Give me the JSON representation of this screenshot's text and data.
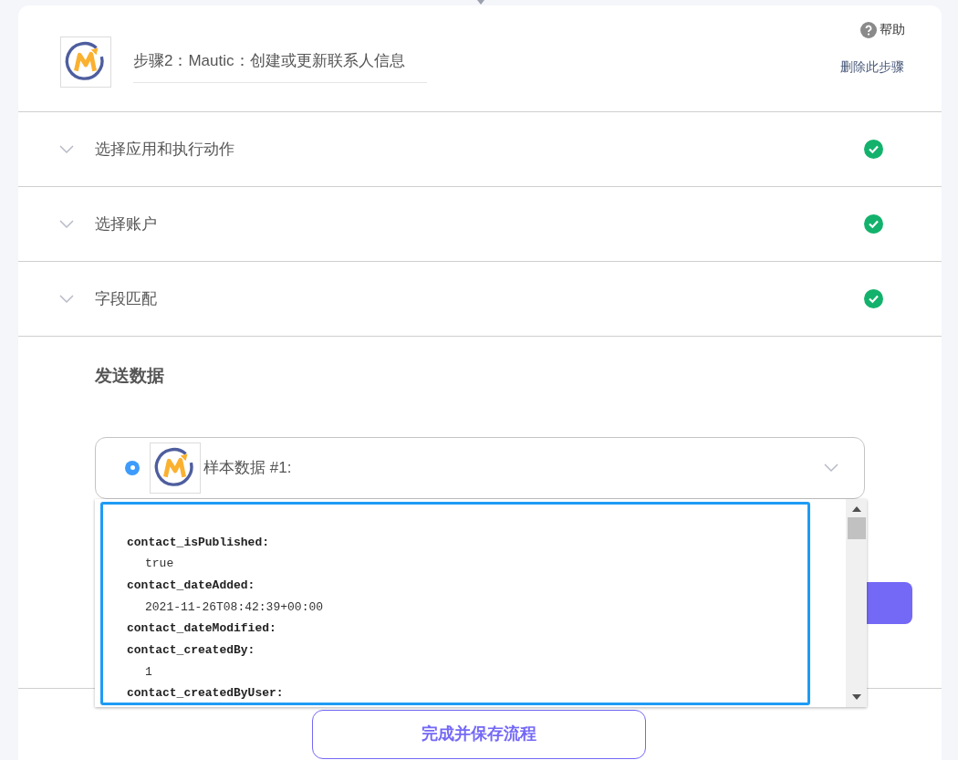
{
  "step": {
    "title": "步骤2：Mautic：创建或更新联系人信息",
    "help": "帮助",
    "delete": "删除此步骤"
  },
  "sections": [
    {
      "label": "选择应用和执行动作",
      "done": true,
      "expanded": false
    },
    {
      "label": "选择账户",
      "done": true,
      "expanded": false
    },
    {
      "label": "字段匹配",
      "done": true,
      "expanded": false
    }
  ],
  "send_data": {
    "title": "发送数据",
    "sample": {
      "label": "样本数据 #1:",
      "selected": true,
      "expanded": true
    },
    "lines": [
      {
        "kind": "key",
        "text": "contact_isPublished:"
      },
      {
        "kind": "value",
        "text": "true"
      },
      {
        "kind": "key",
        "text": "contact_dateAdded:"
      },
      {
        "kind": "value",
        "text": "2021-11-26T08:42:39+00:00"
      },
      {
        "kind": "key",
        "text": "contact_dateModified:"
      },
      {
        "kind": "key",
        "text": "contact_createdBy:"
      },
      {
        "kind": "value",
        "text": "1"
      },
      {
        "kind": "key",
        "text": "contact_createdByUser:"
      }
    ]
  },
  "finish_button": "完成并保存流程"
}
